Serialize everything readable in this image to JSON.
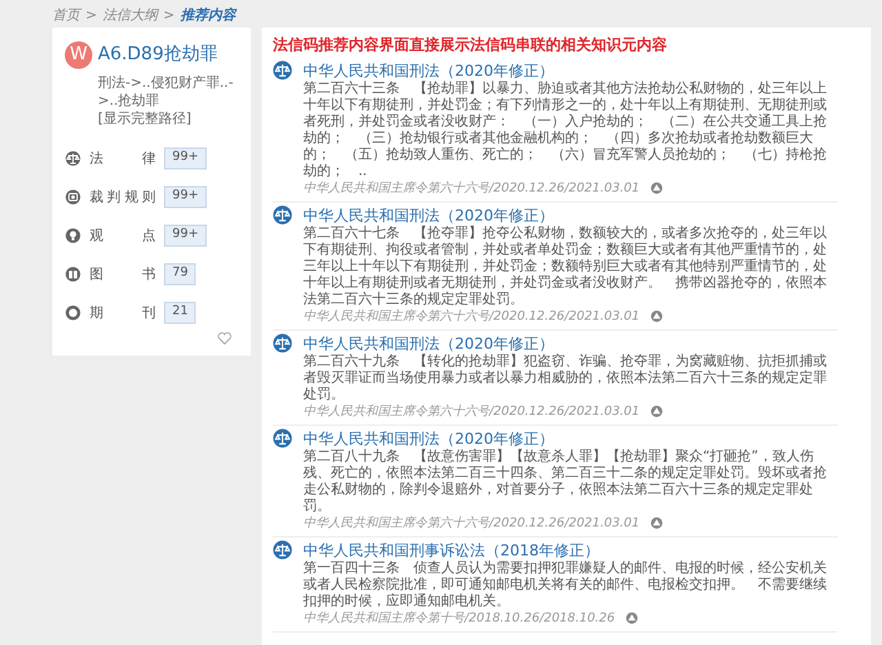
{
  "breadcrumb": [
    {
      "label": "首页",
      "kind": "link"
    },
    {
      "label": ">",
      "kind": "separator"
    },
    {
      "label": "法信大纲",
      "kind": "link"
    },
    {
      "label": ">",
      "kind": "separator"
    },
    {
      "label": "推荐内容",
      "kind": "current"
    }
  ],
  "sidebar": {
    "avatar_letter": "W",
    "title": "A6.D89抢劫罪",
    "path": "刑法->..侵犯财产罪..->..抢劫罪",
    "path_link": "[显示完整路径]",
    "items": [
      {
        "label": "法　律",
        "count": "99+",
        "kind": "law"
      },
      {
        "label": "裁判规则",
        "count": "99+",
        "kind": "rule"
      },
      {
        "label": "观　点",
        "count": "99+",
        "kind": "view"
      },
      {
        "label": "图　书",
        "count": "79",
        "kind": "book"
      },
      {
        "label": "期　刊",
        "count": "21",
        "kind": "journal"
      }
    ]
  },
  "headline": "法信码推荐内容界面直接展示法信码串联的相关知识元内容",
  "entries": [
    {
      "title": "中华人民共和国刑法（2020年修正）",
      "text": "第二百六十三条　【抢劫罪】以暴力、胁迫或者其他方法抢劫公私财物的，处三年以上十年以下有期徒刑，并处罚金；有下列情形之一的，处十年以上有期徒刑、无期徒刑或者死刑，并处罚金或者没收财产：　（一）入户抢劫的；　（二）在公共交通工具上抢劫的；　（三）抢劫银行或者其他金融机构的；　（四）多次抢劫或者抢劫数额巨大的；　（五）抢劫致人重伤、死亡的；　（六）冒充军警人员抢劫的；　（七）持枪抢劫的；　..",
      "source": "中华人民共和国主席令第六十六号/2020.12.26/2021.03.01"
    },
    {
      "title": "中华人民共和国刑法（2020年修正）",
      "text": "第二百六十七条　【抢夺罪】抢夺公私财物，数额较大的，或者多次抢夺的，处三年以下有期徒刑、拘役或者管制，并处或者单处罚金；数额巨大或者有其他严重情节的，处三年以上十年以下有期徒刑，并处罚金；数额特别巨大或者有其他特别严重情节的，处十年以上有期徒刑或者无期徒刑，并处罚金或者没收财产。　携带凶器抢夺的，依照本法第二百六十三条的规定定罪处罚。",
      "source": "中华人民共和国主席令第六十六号/2020.12.26/2021.03.01"
    },
    {
      "title": "中华人民共和国刑法（2020年修正）",
      "text": "第二百六十九条　【转化的抢劫罪】犯盗窃、诈骗、抢夺罪，为窝藏赃物、抗拒抓捕或者毁灭罪证而当场使用暴力或者以暴力相威胁的，依照本法第二百六十三条的规定定罪处罚。",
      "source": "中华人民共和国主席令第六十六号/2020.12.26/2021.03.01"
    },
    {
      "title": "中华人民共和国刑法（2020年修正）",
      "text": "第二百八十九条　【故意伤害罪】【故意杀人罪】【抢劫罪】聚众“打砸抢”，致人伤残、死亡的，依照本法第二百三十四条、第二百三十二条的规定定罪处罚。毁坏或者抢走公私财物的，除判令退赔外，对首要分子，依照本法第二百六十三条的规定定罪处罚。",
      "source": "中华人民共和国主席令第六十六号/2020.12.26/2021.03.01"
    },
    {
      "title": "中华人民共和国刑事诉讼法（2018年修正）",
      "text": "第一百四十三条　侦查人员认为需要扣押犯罪嫌疑人的邮件、电报的时候，经公安机关或者人民检察院批准，即可通知邮电机关将有关的邮件、电报检交扣押。　不需要继续扣押的时候，应即通知邮电机关。",
      "source": "中华人民共和国主席令第十号/2018.10.26/2018.10.26"
    }
  ]
}
